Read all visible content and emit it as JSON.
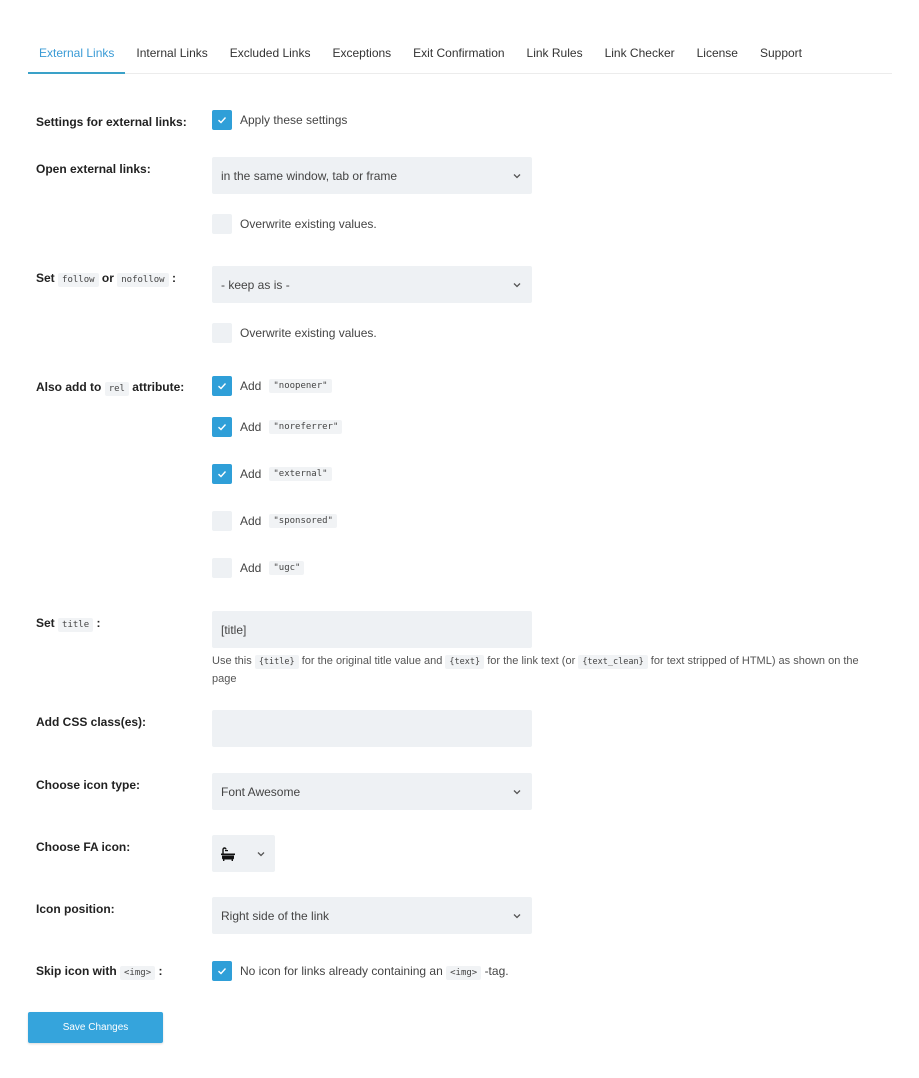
{
  "tabs": [
    {
      "label": "External Links",
      "active": true
    },
    {
      "label": "Internal Links"
    },
    {
      "label": "Excluded Links"
    },
    {
      "label": "Exceptions"
    },
    {
      "label": "Exit Confirmation"
    },
    {
      "label": "Link Rules"
    },
    {
      "label": "Link Checker"
    },
    {
      "label": "License"
    },
    {
      "label": "Support"
    }
  ],
  "settings": {
    "label": "Settings for external links:",
    "apply_label": "Apply these settings",
    "apply_checked": true
  },
  "open_links": {
    "label": "Open external links:",
    "value": "in the same window, tab or frame",
    "overwrite_label": "Overwrite existing values.",
    "overwrite_checked": false
  },
  "follow": {
    "label_prefix": "Set",
    "code1": "follow",
    "label_mid": "or",
    "code2": "nofollow",
    "label_suffix": ":",
    "value": "- keep as is -",
    "overwrite_label": "Overwrite existing values.",
    "overwrite_checked": false
  },
  "rel": {
    "label_prefix": "Also add to",
    "code": "rel",
    "label_suffix": "attribute:",
    "items": [
      {
        "prefix": "Add",
        "value": "\"noopener\"",
        "checked": true
      },
      {
        "prefix": "Add",
        "value": "\"noreferrer\"",
        "checked": true
      },
      {
        "prefix": "Add",
        "value": "\"external\"",
        "checked": true
      },
      {
        "prefix": "Add",
        "value": "\"sponsored\"",
        "checked": false
      },
      {
        "prefix": "Add",
        "value": "\"ugc\"",
        "checked": false
      }
    ]
  },
  "title": {
    "label_prefix": "Set",
    "code": "title",
    "label_suffix": ":",
    "value": "[title]",
    "help": {
      "t1": "Use this",
      "c1": "{title}",
      "t2": "for the original title value and",
      "c2": "{text}",
      "t3": "for the link text (or",
      "c3": "{text_clean}",
      "t4": "for text stripped of HTML) as shown on the page"
    }
  },
  "css_class": {
    "label": "Add CSS class(es):",
    "value": ""
  },
  "icon_type": {
    "label": "Choose icon type:",
    "value": "Font Awesome"
  },
  "fa_icon": {
    "label": "Choose FA icon:",
    "icon": "bath-icon"
  },
  "icon_position": {
    "label": "Icon position:",
    "value": "Right side of the link"
  },
  "skip_icon": {
    "label_prefix": "Skip icon with",
    "code": "<img>",
    "label_suffix": ":",
    "checked": true,
    "text1": "No icon for links already containing an",
    "code2": "<img>",
    "text2": "-tag."
  },
  "save_label": "Save Changes",
  "colors": {
    "accent": "#2f9fd8",
    "field_bg": "#eef1f4",
    "active_tab": "#3a9bd6"
  }
}
